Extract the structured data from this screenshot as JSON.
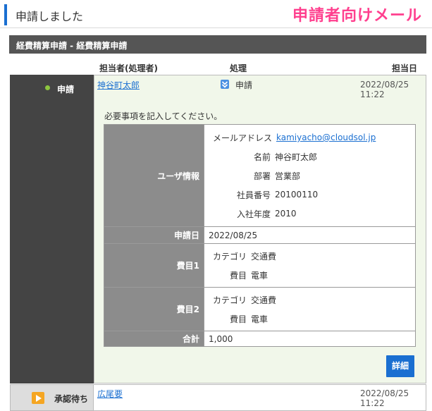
{
  "header": {
    "title": "申請しました",
    "badge": "申請者向けメール"
  },
  "section": {
    "title": "経費精算申請 - 経費精算申請"
  },
  "columns": {
    "assignee": "担当者(処理者)",
    "action": "処理",
    "date": "担当日"
  },
  "rows": [
    {
      "status": "申請",
      "assignee": "神谷町太郎",
      "action": "申請",
      "date": "2022/08/25 11:22"
    },
    {
      "status": "承認待ち",
      "assignee": "広尾要",
      "date": "2022/08/25 11:22"
    }
  ],
  "form": {
    "instruction": "必要事項を記入してください。",
    "user_info": {
      "label": "ユーザ情報",
      "fields": [
        {
          "k": "メールアドレス",
          "v": "kamiyacho@cloudsol.jp"
        },
        {
          "k": "名前",
          "v": "神谷町太郎"
        },
        {
          "k": "部署",
          "v": "営業部"
        },
        {
          "k": "社員番号",
          "v": "20100110"
        },
        {
          "k": "入社年度",
          "v": "2010"
        }
      ]
    },
    "application_date": {
      "label": "申請日",
      "value": "2022/08/25"
    },
    "expense1": {
      "label": "費目1",
      "fields": [
        {
          "k": "カテゴリ",
          "v": "交通費"
        },
        {
          "k": "費目",
          "v": "電車"
        }
      ]
    },
    "expense2": {
      "label": "費目2",
      "fields": [
        {
          "k": "カテゴリ",
          "v": "交通費"
        },
        {
          "k": "費目",
          "v": "電車"
        }
      ]
    },
    "total": {
      "label": "合計",
      "value": "1,000"
    }
  },
  "detail_button": "詳細",
  "colors": {
    "accent": "#1a6fd1",
    "badge": "#ff3f8e",
    "status_dot": "#8dc63f",
    "waiting_icon": "#f5a623"
  },
  "icons": {
    "action": "arrow-down-icon",
    "waiting": "play-icon",
    "status": "status-dot-icon"
  }
}
